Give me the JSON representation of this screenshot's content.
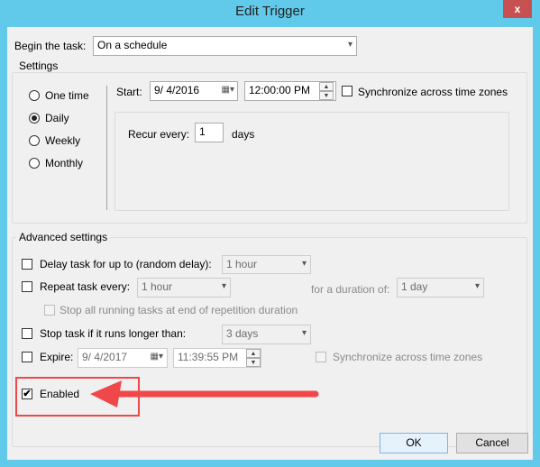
{
  "window": {
    "title": "Edit Trigger",
    "close_icon": "x"
  },
  "begin": {
    "label": "Begin the task:",
    "value": "On a schedule"
  },
  "settings": {
    "label": "Settings",
    "schedule_options": [
      {
        "label": "One time",
        "selected": false
      },
      {
        "label": "Daily",
        "selected": true
      },
      {
        "label": "Weekly",
        "selected": false
      },
      {
        "label": "Monthly",
        "selected": false
      }
    ],
    "start_label": "Start:",
    "start_date": "9/  4/2016",
    "start_time": "12:00:00 PM",
    "sync_label": "Synchronize across time zones",
    "sync_checked": false,
    "recur_label": "Recur every:",
    "recur_value": "1",
    "recur_unit": "days"
  },
  "advanced": {
    "label": "Advanced settings",
    "delay": {
      "label": "Delay task for up to (random delay):",
      "value": "1 hour",
      "checked": false
    },
    "repeat": {
      "label": "Repeat task every:",
      "value": "1 hour",
      "checked": false,
      "duration_label": "for a duration of:",
      "duration_value": "1 day"
    },
    "stop_all": {
      "label": "Stop all running tasks at end of repetition duration",
      "checked": false
    },
    "stop_task": {
      "label": "Stop task if it runs longer than:",
      "value": "3 days",
      "checked": false
    },
    "expire": {
      "label": "Expire:",
      "date": "9/  4/2017",
      "time": "11:39:55 PM",
      "checked": false,
      "sync_label": "Synchronize across time zones"
    },
    "enabled": {
      "label": "Enabled",
      "checked": true,
      "check_mark": "✔"
    }
  },
  "buttons": {
    "ok": "OK",
    "cancel": "Cancel"
  },
  "annotation": {
    "color": "#f0474a"
  }
}
